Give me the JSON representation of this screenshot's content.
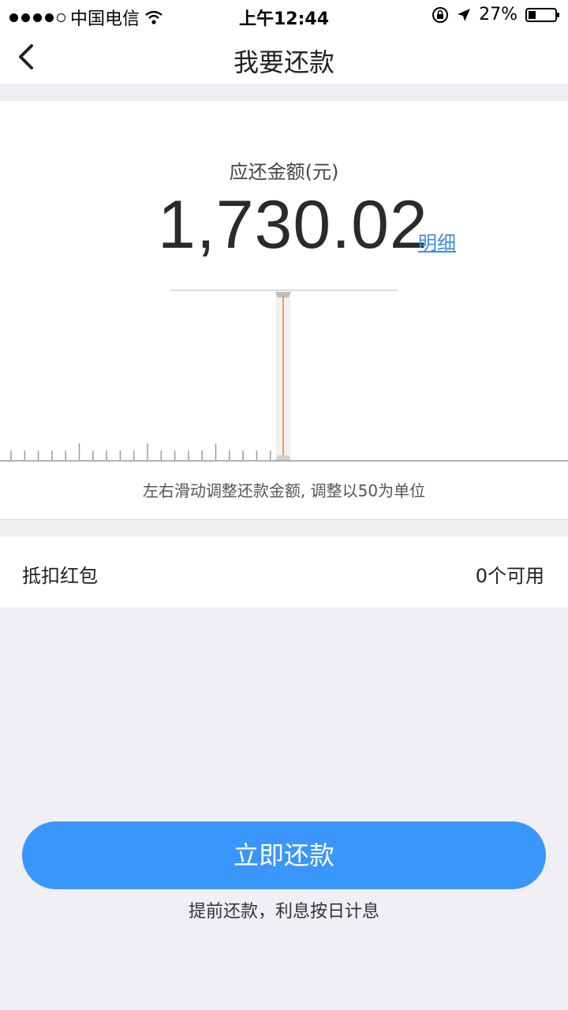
{
  "status_bar": {
    "carrier": "中国电信",
    "time": "上午12:44",
    "battery": "27%",
    "icons": [
      "signal-dots-icon",
      "wifi-icon",
      "rotation-lock-icon",
      "location-arrow-icon",
      "battery-icon"
    ]
  },
  "nav": {
    "title": "我要还款",
    "back_icon": "chevron-left-icon"
  },
  "amount": {
    "label": "应还金额(元)",
    "value": "1,730.02",
    "detail_link": "明细"
  },
  "slider": {
    "hint": "左右滑动调整还款金额, 调整以50为单位",
    "accent_color": "#f0a04b"
  },
  "coupon": {
    "label": "抵扣红包",
    "value": "0个可用"
  },
  "pay": {
    "button_label": "立即还款",
    "footnote": "提前还款，利息按日计息",
    "color": "#3b96fb"
  }
}
